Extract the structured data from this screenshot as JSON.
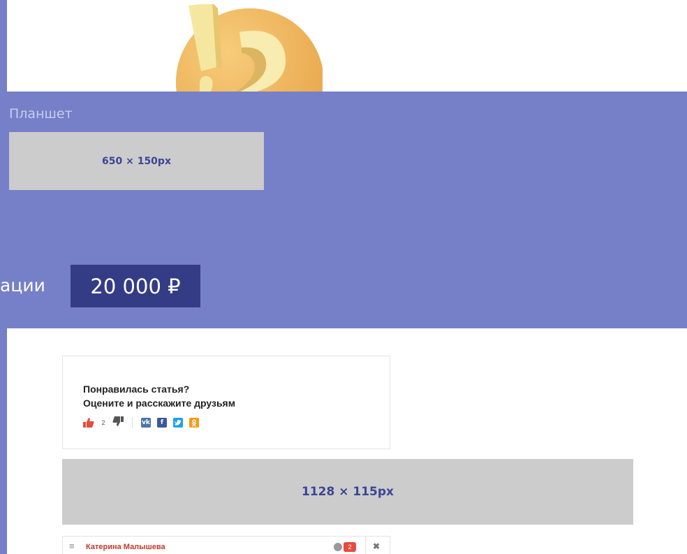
{
  "colors": {
    "band": "#7580c8",
    "badge": "#353c86",
    "ad_text": "#3d4596",
    "ad_box": "#cccccc",
    "like": "#e74c3c",
    "vk": "#4a76a8",
    "facebook": "#3b5998",
    "twitter": "#1da1f2",
    "odnoklassniki": "#f59a1a"
  },
  "tablet_section": {
    "label": "Планшет",
    "ad_size": "650 × 150px"
  },
  "price": {
    "caption": "ации",
    "value": "20 000 ₽"
  },
  "share_card": {
    "title_line1": "Понравилась статья?",
    "title_line2": "Оцените и расскажите друзьям",
    "likes": "2",
    "icons": [
      "thumbs-up-icon",
      "thumbs-down-icon",
      "vk-icon",
      "facebook-icon",
      "twitter-icon",
      "odnoklassniki-icon"
    ]
  },
  "wide_ad": {
    "size": "1128 × 115px"
  },
  "chat_bar": {
    "name": "Катерина Малышева",
    "badge_count": "2",
    "menu_glyph": "≡",
    "close_glyph": "✖"
  }
}
